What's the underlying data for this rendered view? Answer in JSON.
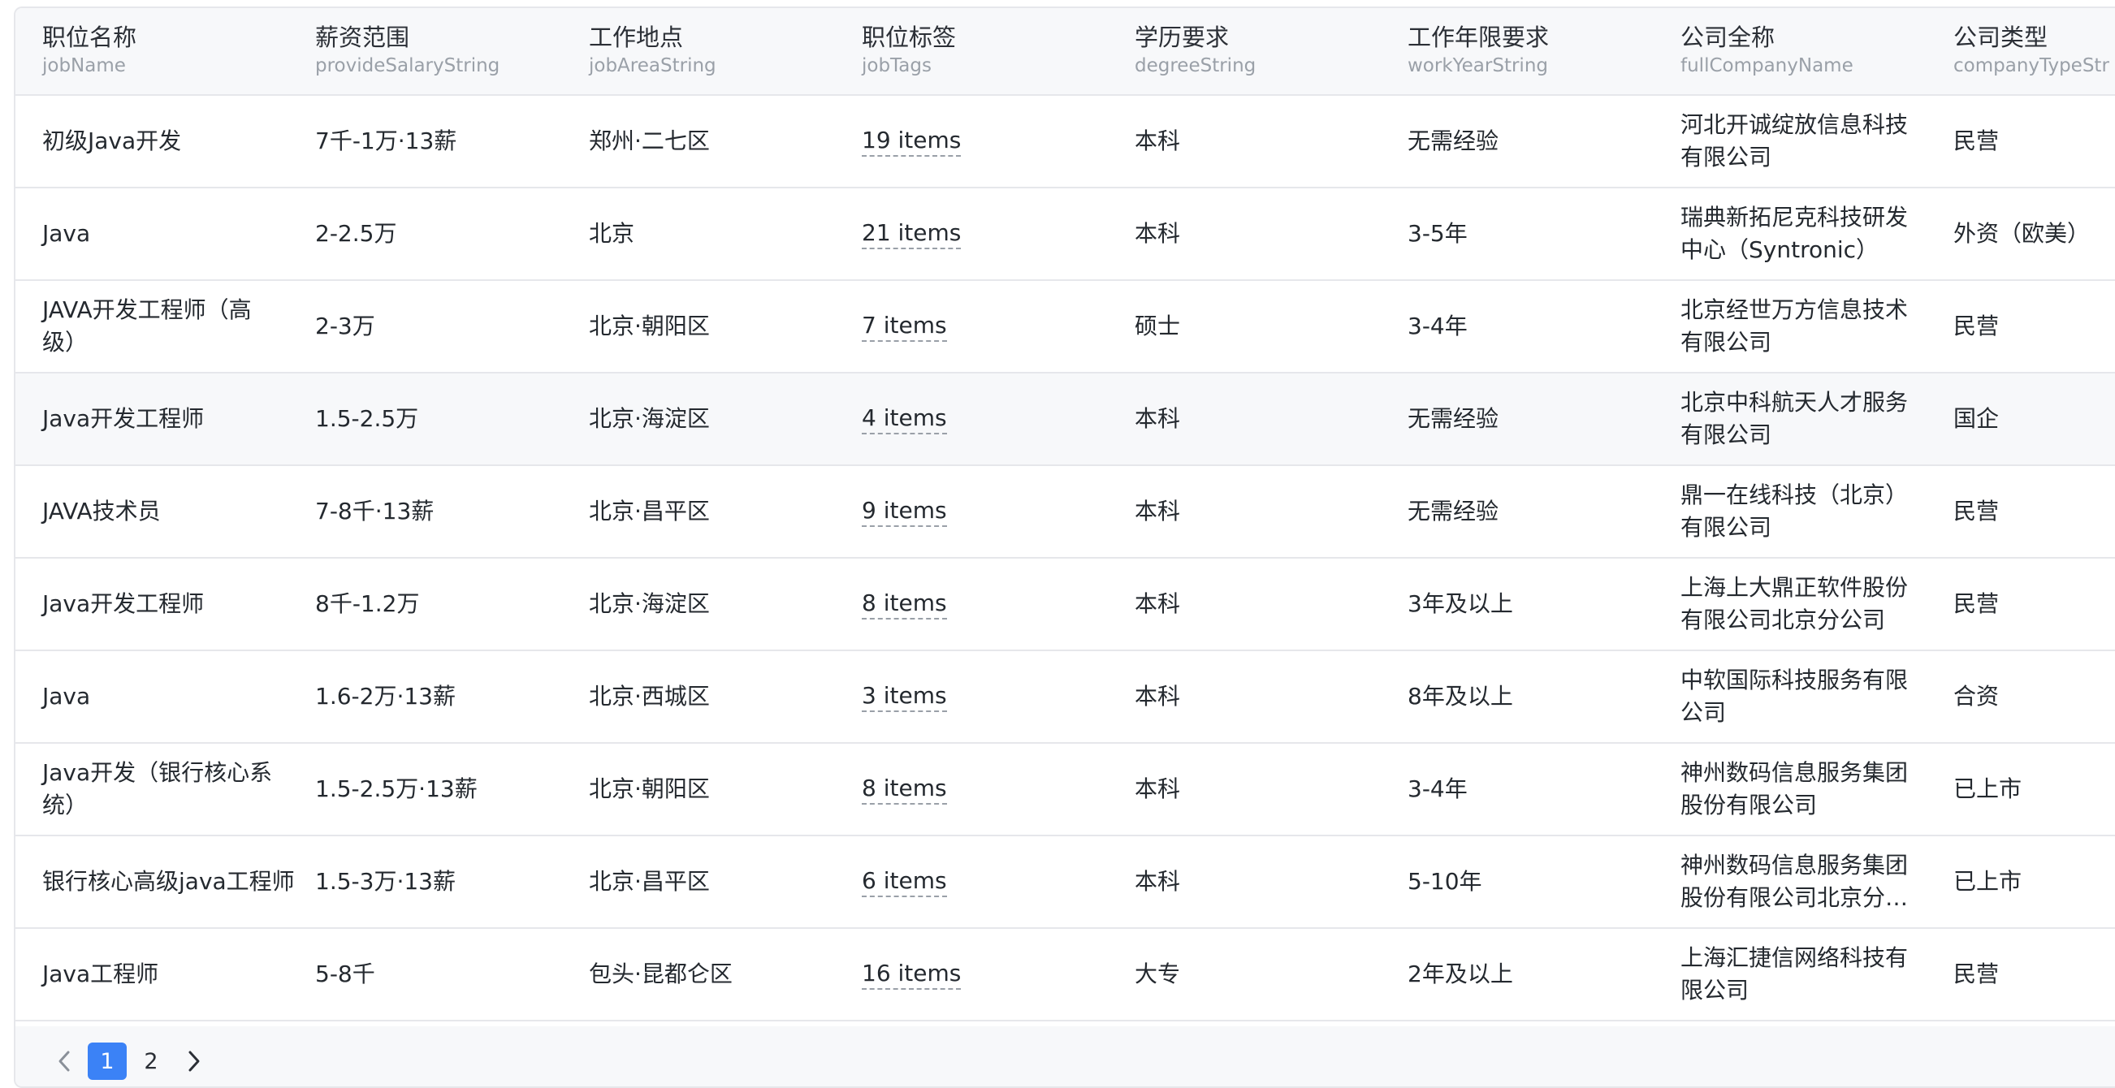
{
  "columns": [
    {
      "title": "职位名称",
      "key": "jobName"
    },
    {
      "title": "薪资范围",
      "key": "provideSalaryString"
    },
    {
      "title": "工作地点",
      "key": "jobAreaString"
    },
    {
      "title": "职位标签",
      "key": "jobTags"
    },
    {
      "title": "学历要求",
      "key": "degreeString"
    },
    {
      "title": "工作年限要求",
      "key": "workYearString"
    },
    {
      "title": "公司全称",
      "key": "fullCompanyName"
    },
    {
      "title": "公司类型",
      "key": "companyTypeStr"
    }
  ],
  "rows": [
    {
      "jobName": "初级Java开发",
      "salary": "7千-1万·13薪",
      "area": "郑州·二七区",
      "tags": "19 items",
      "degree": "本科",
      "workYear": "无需经验",
      "company": "河北开诚绽放信息科技有限公司",
      "companyType": "民营"
    },
    {
      "jobName": "Java",
      "salary": "2-2.5万",
      "area": "北京",
      "tags": "21 items",
      "degree": "本科",
      "workYear": "3-5年",
      "company": "瑞典新拓尼克科技研发中心（Syntronic）",
      "companyType": "外资（欧美）"
    },
    {
      "jobName": "JAVA开发工程师（高级）",
      "salary": "2-3万",
      "area": "北京·朝阳区",
      "tags": "7 items",
      "degree": "硕士",
      "workYear": "3-4年",
      "company": "北京经世万方信息技术有限公司",
      "companyType": "民营"
    },
    {
      "jobName": "Java开发工程师",
      "salary": "1.5-2.5万",
      "area": "北京·海淀区",
      "tags": "4 items",
      "degree": "本科",
      "workYear": "无需经验",
      "company": "北京中科航天人才服务有限公司",
      "companyType": "国企"
    },
    {
      "jobName": "JAVA技术员",
      "salary": "7-8千·13薪",
      "area": "北京·昌平区",
      "tags": "9 items",
      "degree": "本科",
      "workYear": "无需经验",
      "company": "鼎一在线科技（北京）有限公司",
      "companyType": "民营"
    },
    {
      "jobName": "Java开发工程师",
      "salary": "8千-1.2万",
      "area": "北京·海淀区",
      "tags": "8 items",
      "degree": "本科",
      "workYear": "3年及以上",
      "company": "上海上大鼎正软件股份有限公司北京分公司",
      "companyType": "民营"
    },
    {
      "jobName": "Java",
      "salary": "1.6-2万·13薪",
      "area": "北京·西城区",
      "tags": "3 items",
      "degree": "本科",
      "workYear": "8年及以上",
      "company": "中软国际科技服务有限公司",
      "companyType": "合资"
    },
    {
      "jobName": "Java开发（银行核心系统）",
      "salary": "1.5-2.5万·13薪",
      "area": "北京·朝阳区",
      "tags": "8 items",
      "degree": "本科",
      "workYear": "3-4年",
      "company": "神州数码信息服务集团股份有限公司",
      "companyType": "已上市"
    },
    {
      "jobName": "银行核心高级java工程师",
      "salary": "1.5-3万·13薪",
      "area": "北京·昌平区",
      "tags": "6 items",
      "degree": "本科",
      "workYear": "5-10年",
      "company": "神州数码信息服务集团股份有限公司北京分公司",
      "companyType": "已上市"
    },
    {
      "jobName": "Java工程师",
      "salary": "5-8千",
      "area": "包头·昆都仑区",
      "tags": "16 items",
      "degree": "大专",
      "workYear": "2年及以上",
      "company": "上海汇捷信网络科技有限公司",
      "companyType": "民营"
    }
  ],
  "pagination": {
    "prev_icon": "chevron-left-icon",
    "next_icon": "chevron-right-icon",
    "pages": [
      "1",
      "2"
    ],
    "current": "1"
  },
  "colors": {
    "accent": "#3b82f6",
    "header_bg": "#f7f8fa",
    "border": "#e6e7eb",
    "muted_text": "#9aa0a8"
  }
}
